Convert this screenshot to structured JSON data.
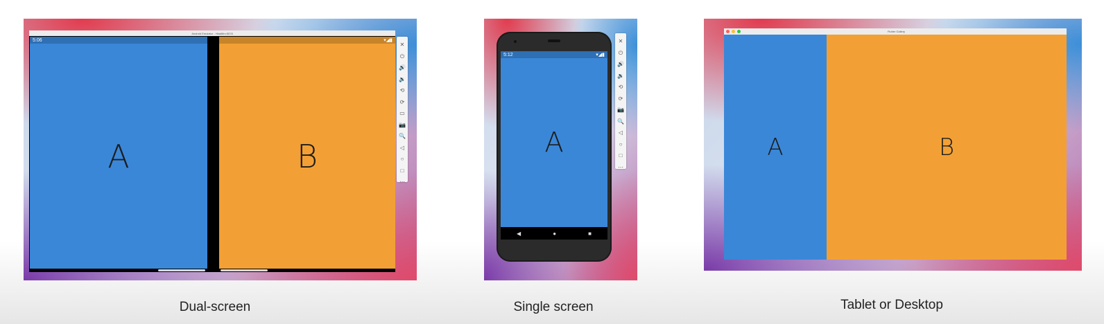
{
  "panels": {
    "dual": {
      "window_title": "Android Emulator - Hbal6fm:5578",
      "status_time": "5:06",
      "status_icons": "▾◢▮",
      "pane_a": "A",
      "pane_b": "B",
      "caption": "Dual-screen",
      "toolbar_icons": [
        "✕",
        "⏻",
        "🔊",
        "🔉",
        "⟲",
        "⟳",
        "▭",
        "📷",
        "🔍",
        "◁",
        "○",
        "□",
        "⋯"
      ]
    },
    "single": {
      "status_time": "5:12",
      "status_icons": "▾◢▮",
      "pane_a": "A",
      "nav_back": "◀",
      "nav_home": "●",
      "nav_recent": "■",
      "caption": "Single screen",
      "toolbar_icons": [
        "✕",
        "⏻",
        "🔊",
        "🔉",
        "⟲",
        "⟳",
        "📷",
        "🔍",
        "◁",
        "○",
        "□",
        "⋯"
      ]
    },
    "tablet": {
      "window_title": "Flutter Gallery",
      "pane_a": "A",
      "pane_b": "B",
      "caption": "Tablet or Desktop"
    }
  },
  "colors": {
    "pane_blue": "#3a87d8",
    "pane_orange": "#f2a035"
  }
}
